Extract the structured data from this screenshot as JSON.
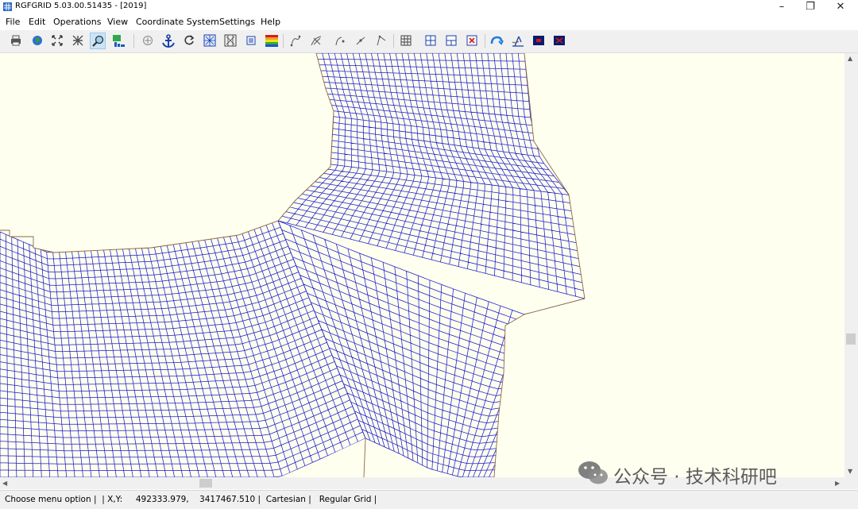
{
  "window": {
    "title": "RGFGRID 5.03.00.51435 - [2019]",
    "minimize_glyph": "–",
    "restore_glyph": "❐",
    "close_glyph": "✕"
  },
  "menu": {
    "items": [
      "File",
      "Edit",
      "Operations",
      "View",
      "Coordinate System",
      "Settings",
      "Help"
    ]
  },
  "toolbar": {
    "buttons": [
      "print-icon",
      "globe-icon",
      "zoom-extent-icon",
      "zoom-fit-icon",
      "zoom-box-icon",
      "grid-overview-icon",
      "pan-crosshair-icon",
      "anchor-icon",
      "refresh-icon",
      "grid-property-icon",
      "grid-property-2-icon",
      "legend-icon",
      "color-bar-icon",
      "spline-draw-icon",
      "spline-delete-icon",
      "spline-insert-icon",
      "spline-move-icon",
      "spline-split-icon",
      "grid-icon",
      "grid-refine-icon",
      "grid-derefine-icon",
      "grid-delete-icon",
      "orthogonalize-icon",
      "land-boundary-icon",
      "sample-icon",
      "sample-2-icon"
    ],
    "active": "zoom-box-icon"
  },
  "status": {
    "menu_option": "Choose menu option",
    "xy_label": "X,Y:",
    "x_value": "492333.979,",
    "y_value": "3417467.510",
    "coordinate_system": "Cartesian",
    "grid_type": "Regular Grid"
  },
  "colors": {
    "grid": "#1a1acc",
    "canvas_background": "#fffff0",
    "boundary": "#8b6a3e"
  },
  "watermark": {
    "text": "公众号 · 技术科研吧",
    "icon": "wechat-icon"
  }
}
